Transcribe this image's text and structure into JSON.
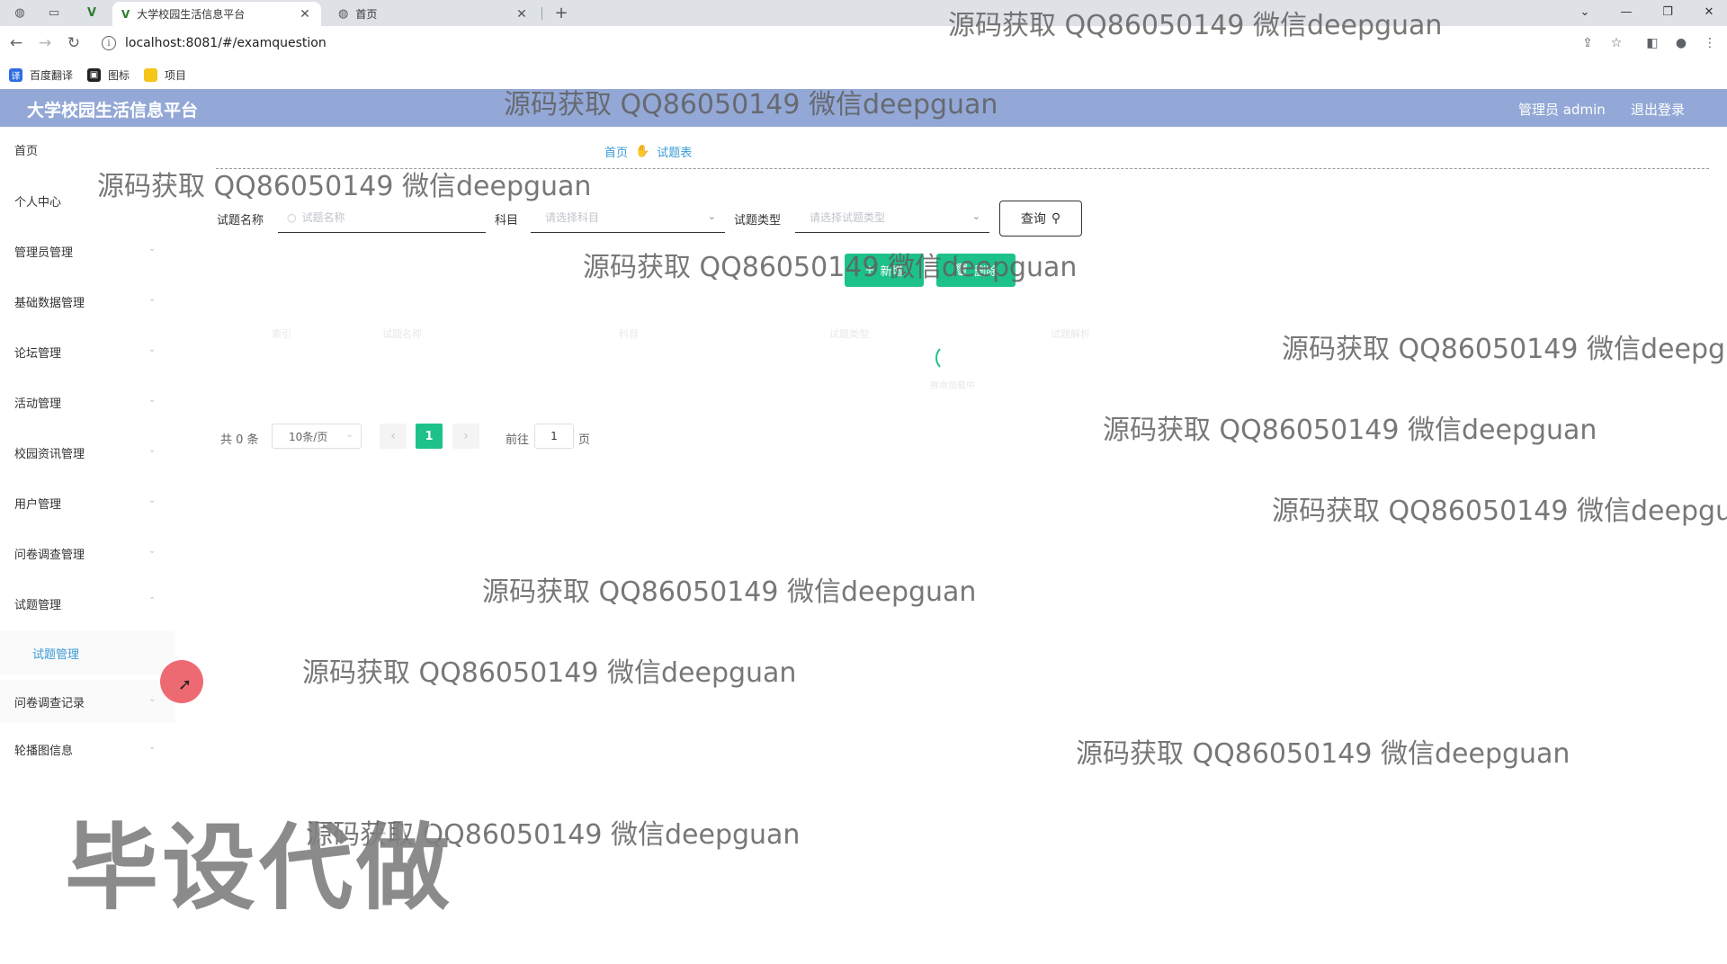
{
  "browser": {
    "tabs": [
      {
        "title": "大学校园生活信息平台",
        "close": "✕"
      },
      {
        "title": "首页",
        "close": "✕"
      }
    ],
    "new_tab": "+",
    "url": "localhost:8081/#/examquestion",
    "bookmarks": [
      {
        "label": "百度翻译",
        "color": "#2f6de1"
      },
      {
        "label": "图标",
        "color": "#222222"
      },
      {
        "label": "项目",
        "color": "#f5c518"
      }
    ]
  },
  "header": {
    "title": "大学校园生活信息平台",
    "user": "管理员 admin",
    "logout": "退出登录",
    "bg_color": "#93a8d6"
  },
  "sidebar": {
    "items": [
      {
        "label": "首页"
      },
      {
        "label": "个人中心"
      },
      {
        "label": "管理员管理"
      },
      {
        "label": "基础数据管理"
      },
      {
        "label": "论坛管理"
      },
      {
        "label": "活动管理"
      },
      {
        "label": "校园资讯管理"
      },
      {
        "label": "用户管理"
      },
      {
        "label": "问卷调查管理"
      },
      {
        "label": "试题管理"
      },
      {
        "label": "试题管理"
      },
      {
        "label": "问卷调查记录"
      },
      {
        "label": "轮播图信息"
      }
    ]
  },
  "breadcrumb": {
    "home": "首页",
    "current": "试题表"
  },
  "search": {
    "name_label": "试题名称",
    "name_placeholder": "试题名称",
    "subject_label": "科目",
    "subject_placeholder": "请选择科目",
    "type_label": "试题类型",
    "type_placeholder": "请选择试题类型",
    "button": "查询"
  },
  "actions": {
    "add": "新增",
    "delete": "删除",
    "accent_color": "#1dc18a"
  },
  "table": {
    "headers": [
      "索引",
      "试题名称",
      "科目",
      "试题类型",
      "试题解析"
    ],
    "loading_text": "拼命加载中"
  },
  "pagination": {
    "total": "共 0 条",
    "page_size": "10条/页",
    "prev": "‹",
    "current": "1",
    "next": "›",
    "goto_label": "前往",
    "goto_value": "1",
    "goto_unit": "页"
  },
  "overlay": {
    "watermark": "源码获取 QQ86050149 微信deepguan",
    "big_text": "毕设代做"
  }
}
